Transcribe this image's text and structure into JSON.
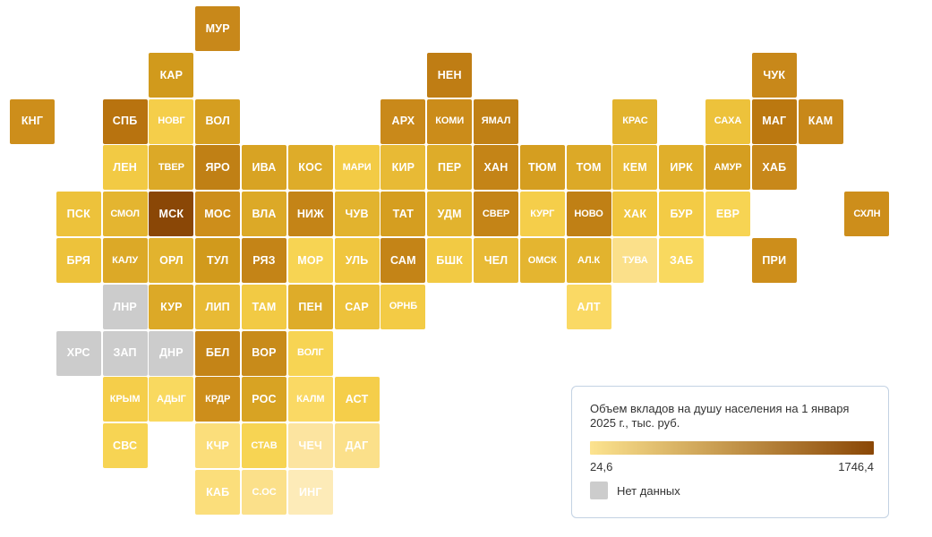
{
  "legend": {
    "title": "Объем вкладов на душу населения на 1 января 2025 г., тыс. руб.",
    "min_label": "24,6",
    "max_label": "1746,4",
    "gradient_start": "#FCE38F",
    "gradient_end": "#8A4706",
    "nodata_label": "Нет данных",
    "nodata_color": "#CCCCCC",
    "border_color": "#C3D2E3"
  },
  "chart_data": {
    "type": "heatmap",
    "title": "Объем вкладов на душу населения на 1 января 2025 г., тыс. руб.",
    "xlabel": "",
    "ylabel": "",
    "grid": false,
    "legend_position": "bottom-right",
    "value_range": [
      24.6,
      1746.4
    ],
    "colorscale": [
      "#FCE38F",
      "#8A4706"
    ],
    "nodata_color": "#CCCCCC",
    "grid_origin": {
      "x": 11,
      "y": 7
    },
    "cell_size": 50,
    "cell_pitch": 51.8,
    "categories": [
      "МУР",
      "КАР",
      "КНГ",
      "СПБ",
      "НОВГ",
      "ВОЛ",
      "НЕН",
      "АРХ",
      "КОМИ",
      "ЯМАЛ",
      "КРАС",
      "САХА",
      "ЧУК",
      "МАГ",
      "КАМ",
      "ЛЕН",
      "ТВЕР",
      "ЯРО",
      "ИВА",
      "КОС",
      "МАРИ",
      "КИР",
      "ПЕР",
      "ХАН",
      "ТЮМ",
      "ТОМ",
      "КЕМ",
      "ИРК",
      "АМУР",
      "ХАБ",
      "ПСК",
      "СМОЛ",
      "МСК",
      "МОС",
      "ВЛА",
      "НИЖ",
      "ЧУВ",
      "ТАТ",
      "УДМ",
      "СВЕР",
      "КУРГ",
      "НОВО",
      "ХАК",
      "БУР",
      "ЕВР",
      "СХЛН",
      "БРЯ",
      "КАЛУ",
      "ОРЛ",
      "ТУЛ",
      "РЯЗ",
      "МОР",
      "УЛЬ",
      "САМ",
      "БШК",
      "ЧЕЛ",
      "ОМСК",
      "АЛ.К",
      "ТУВА",
      "ЗАБ",
      "ПРИ",
      "ЛНР",
      "КУР",
      "ЛИП",
      "ТАМ",
      "ПЕН",
      "САР",
      "ОРНБ",
      "АЛТ",
      "ХРС",
      "ЗАП",
      "ДНР",
      "БЕЛ",
      "ВОР",
      "ВОЛГ",
      "КРЫМ",
      "АДЫГ",
      "КРДР",
      "РОС",
      "КАЛМ",
      "АСТ",
      "СВС",
      "КЧР",
      "СТАВ",
      "ЧЕЧ",
      "ДАГ",
      "КАБ",
      "С.ОС",
      "ИНГ"
    ],
    "tiles": [
      {
        "code": "МУР",
        "col": 4,
        "row": 0,
        "color": "#C8881A",
        "nodata": false
      },
      {
        "code": "КАР",
        "col": 3,
        "row": 1,
        "color": "#D19A1C",
        "nodata": false
      },
      {
        "code": "НЕН",
        "col": 9,
        "row": 1,
        "color": "#BF7D14",
        "nodata": false
      },
      {
        "code": "ЧУК",
        "col": 16,
        "row": 1,
        "color": "#C8881A",
        "nodata": false
      },
      {
        "code": "КНГ",
        "col": 0,
        "row": 2,
        "color": "#CD8E1B",
        "nodata": false
      },
      {
        "code": "СПБ",
        "col": 2,
        "row": 2,
        "color": "#B8730F",
        "nodata": false
      },
      {
        "code": "НОВГ",
        "col": 3,
        "row": 2,
        "color": "#F5CE4A",
        "nodata": false
      },
      {
        "code": "ВОЛ",
        "col": 4,
        "row": 2,
        "color": "#D59E20",
        "nodata": false
      },
      {
        "code": "АРХ",
        "col": 8,
        "row": 2,
        "color": "#C9891A",
        "nodata": false
      },
      {
        "code": "КОМИ",
        "col": 9,
        "row": 2,
        "color": "#CB8C1A",
        "nodata": false
      },
      {
        "code": "ЯМАЛ",
        "col": 10,
        "row": 2,
        "color": "#C08015",
        "nodata": false
      },
      {
        "code": "КРАС",
        "col": 13,
        "row": 2,
        "color": "#E2B32E",
        "nodata": false
      },
      {
        "code": "САХА",
        "col": 15,
        "row": 2,
        "color": "#EDC23B",
        "nodata": false
      },
      {
        "code": "МАГ",
        "col": 16,
        "row": 2,
        "color": "#BB7810",
        "nodata": false
      },
      {
        "code": "КАМ",
        "col": 17,
        "row": 2,
        "color": "#C8881A",
        "nodata": false
      },
      {
        "code": "ЛЕН",
        "col": 2,
        "row": 3,
        "color": "#F2CA44",
        "nodata": false
      },
      {
        "code": "ТВЕР",
        "col": 3,
        "row": 3,
        "color": "#DCA927",
        "nodata": false
      },
      {
        "code": "ЯРО",
        "col": 4,
        "row": 3,
        "color": "#C08015",
        "nodata": false
      },
      {
        "code": "ИВА",
        "col": 5,
        "row": 3,
        "color": "#D8A323",
        "nodata": false
      },
      {
        "code": "КОС",
        "col": 6,
        "row": 3,
        "color": "#DEAC29",
        "nodata": false
      },
      {
        "code": "МАРИ",
        "col": 7,
        "row": 3,
        "color": "#F3CB45",
        "nodata": false
      },
      {
        "code": "КИР",
        "col": 8,
        "row": 3,
        "color": "#E8BA35",
        "nodata": false
      },
      {
        "code": "ПЕР",
        "col": 9,
        "row": 3,
        "color": "#DEAC29",
        "nodata": false
      },
      {
        "code": "ХАН",
        "col": 10,
        "row": 3,
        "color": "#C48417",
        "nodata": false
      },
      {
        "code": "ТЮМ",
        "col": 11,
        "row": 3,
        "color": "#D59E20",
        "nodata": false
      },
      {
        "code": "ТОМ",
        "col": 12,
        "row": 3,
        "color": "#DCA927",
        "nodata": false
      },
      {
        "code": "КЕМ",
        "col": 13,
        "row": 3,
        "color": "#E8BA35",
        "nodata": false
      },
      {
        "code": "ИРК",
        "col": 14,
        "row": 3,
        "color": "#E0AF2B",
        "nodata": false
      },
      {
        "code": "АМУР",
        "col": 15,
        "row": 3,
        "color": "#D59E20",
        "nodata": false
      },
      {
        "code": "ХАБ",
        "col": 16,
        "row": 3,
        "color": "#C8881A",
        "nodata": false
      },
      {
        "code": "ПСК",
        "col": 1,
        "row": 4,
        "color": "#EDC23B",
        "nodata": false
      },
      {
        "code": "СМОЛ",
        "col": 2,
        "row": 4,
        "color": "#E4B530",
        "nodata": false
      },
      {
        "code": "МСК",
        "col": 3,
        "row": 4,
        "color": "#8A4706",
        "nodata": false
      },
      {
        "code": "МОС",
        "col": 4,
        "row": 4,
        "color": "#CD8E1B",
        "nodata": false
      },
      {
        "code": "ВЛА",
        "col": 5,
        "row": 4,
        "color": "#DCA927",
        "nodata": false
      },
      {
        "code": "НИЖ",
        "col": 6,
        "row": 4,
        "color": "#C48417",
        "nodata": false
      },
      {
        "code": "ЧУВ",
        "col": 7,
        "row": 4,
        "color": "#E2B32E",
        "nodata": false
      },
      {
        "code": "ТАТ",
        "col": 8,
        "row": 4,
        "color": "#D59E20",
        "nodata": false
      },
      {
        "code": "УДМ",
        "col": 9,
        "row": 4,
        "color": "#E2B32E",
        "nodata": false
      },
      {
        "code": "СВЕР",
        "col": 10,
        "row": 4,
        "color": "#C48417",
        "nodata": false
      },
      {
        "code": "КУРГ",
        "col": 11,
        "row": 4,
        "color": "#F5CE4A",
        "nodata": false
      },
      {
        "code": "НОВО",
        "col": 12,
        "row": 4,
        "color": "#C08015",
        "nodata": false
      },
      {
        "code": "ХАК",
        "col": 13,
        "row": 4,
        "color": "#F0C63F",
        "nodata": false
      },
      {
        "code": "БУР",
        "col": 14,
        "row": 4,
        "color": "#F3CB45",
        "nodata": false
      },
      {
        "code": "ЕВР",
        "col": 15,
        "row": 4,
        "color": "#F7D453",
        "nodata": false
      },
      {
        "code": "СХЛН",
        "col": 18,
        "row": 4,
        "color": "#CD8E1B",
        "nodata": false
      },
      {
        "code": "БРЯ",
        "col": 1,
        "row": 5,
        "color": "#EDC23B",
        "nodata": false
      },
      {
        "code": "КАЛУ",
        "col": 2,
        "row": 5,
        "color": "#DCA927",
        "nodata": false
      },
      {
        "code": "ОРЛ",
        "col": 3,
        "row": 5,
        "color": "#E2B32E",
        "nodata": false
      },
      {
        "code": "ТУЛ",
        "col": 4,
        "row": 5,
        "color": "#D19A1C",
        "nodata": false
      },
      {
        "code": "РЯЗ",
        "col": 5,
        "row": 5,
        "color": "#C48417",
        "nodata": false
      },
      {
        "code": "МОР",
        "col": 6,
        "row": 5,
        "color": "#F7D453",
        "nodata": false
      },
      {
        "code": "УЛЬ",
        "col": 7,
        "row": 5,
        "color": "#F0C63F",
        "nodata": false
      },
      {
        "code": "САМ",
        "col": 8,
        "row": 5,
        "color": "#C48417",
        "nodata": false
      },
      {
        "code": "БШК",
        "col": 9,
        "row": 5,
        "color": "#F2CA44",
        "nodata": false
      },
      {
        "code": "ЧЕЛ",
        "col": 10,
        "row": 5,
        "color": "#E8BA35",
        "nodata": false
      },
      {
        "code": "ОМСК",
        "col": 11,
        "row": 5,
        "color": "#E4B530",
        "nodata": false
      },
      {
        "code": "АЛ.К",
        "col": 12,
        "row": 5,
        "color": "#E2B32E",
        "nodata": false
      },
      {
        "code": "ТУВА",
        "col": 13,
        "row": 5,
        "color": "#FBE08A",
        "nodata": false
      },
      {
        "code": "ЗАБ",
        "col": 14,
        "row": 5,
        "color": "#F9D95F",
        "nodata": false
      },
      {
        "code": "ПРИ",
        "col": 16,
        "row": 5,
        "color": "#CD8E1B",
        "nodata": false
      },
      {
        "code": "ЛНР",
        "col": 2,
        "row": 6,
        "color": "#CCCCCC",
        "nodata": true
      },
      {
        "code": "КУР",
        "col": 3,
        "row": 6,
        "color": "#DCA927",
        "nodata": false
      },
      {
        "code": "ЛИП",
        "col": 4,
        "row": 6,
        "color": "#E8BA35",
        "nodata": false
      },
      {
        "code": "ТАМ",
        "col": 5,
        "row": 6,
        "color": "#F2CA44",
        "nodata": false
      },
      {
        "code": "ПЕН",
        "col": 6,
        "row": 6,
        "color": "#DEAC29",
        "nodata": false
      },
      {
        "code": "САР",
        "col": 7,
        "row": 6,
        "color": "#EDC23B",
        "nodata": false
      },
      {
        "code": "ОРНБ",
        "col": 8,
        "row": 6,
        "color": "#F3CB45",
        "nodata": false
      },
      {
        "code": "АЛТ",
        "col": 12,
        "row": 6,
        "color": "#FAD964",
        "nodata": false
      },
      {
        "code": "ХРС",
        "col": 1,
        "row": 7,
        "color": "#CCCCCC",
        "nodata": true
      },
      {
        "code": "ЗАП",
        "col": 2,
        "row": 7,
        "color": "#CCCCCC",
        "nodata": true
      },
      {
        "code": "ДНР",
        "col": 3,
        "row": 7,
        "color": "#CCCCCC",
        "nodata": true
      },
      {
        "code": "БЕЛ",
        "col": 4,
        "row": 7,
        "color": "#C48417",
        "nodata": false
      },
      {
        "code": "ВОР",
        "col": 5,
        "row": 7,
        "color": "#C88B1A",
        "nodata": false
      },
      {
        "code": "ВОЛГ",
        "col": 6,
        "row": 7,
        "color": "#F7D453",
        "nodata": false
      },
      {
        "code": "КРЫМ",
        "col": 2,
        "row": 8,
        "color": "#F5CE4A",
        "nodata": false
      },
      {
        "code": "АДЫГ",
        "col": 3,
        "row": 8,
        "color": "#F9D95F",
        "nodata": false
      },
      {
        "code": "КРДР",
        "col": 4,
        "row": 8,
        "color": "#CD8E1B",
        "nodata": false
      },
      {
        "code": "РОС",
        "col": 5,
        "row": 8,
        "color": "#D8A323",
        "nodata": false
      },
      {
        "code": "КАЛМ",
        "col": 6,
        "row": 8,
        "color": "#FAD964",
        "nodata": false
      },
      {
        "code": "АСТ",
        "col": 7,
        "row": 8,
        "color": "#F5CE4A",
        "nodata": false
      },
      {
        "code": "СВС",
        "col": 2,
        "row": 9,
        "color": "#F7D453",
        "nodata": false
      },
      {
        "code": "КЧР",
        "col": 4,
        "row": 9,
        "color": "#FBDE7B",
        "nodata": false
      },
      {
        "code": "СТАВ",
        "col": 5,
        "row": 9,
        "color": "#F7D453",
        "nodata": false
      },
      {
        "code": "ЧЕЧ",
        "col": 6,
        "row": 9,
        "color": "#FCE4A0",
        "nodata": false
      },
      {
        "code": "ДАГ",
        "col": 7,
        "row": 9,
        "color": "#FBE08A",
        "nodata": false
      },
      {
        "code": "КАБ",
        "col": 4,
        "row": 10,
        "color": "#FBDE7B",
        "nodata": false
      },
      {
        "code": "С.ОС",
        "col": 5,
        "row": 10,
        "color": "#FBE08A",
        "nodata": false
      },
      {
        "code": "ИНГ",
        "col": 6,
        "row": 10,
        "color": "#FDEBB8",
        "nodata": false
      }
    ]
  }
}
